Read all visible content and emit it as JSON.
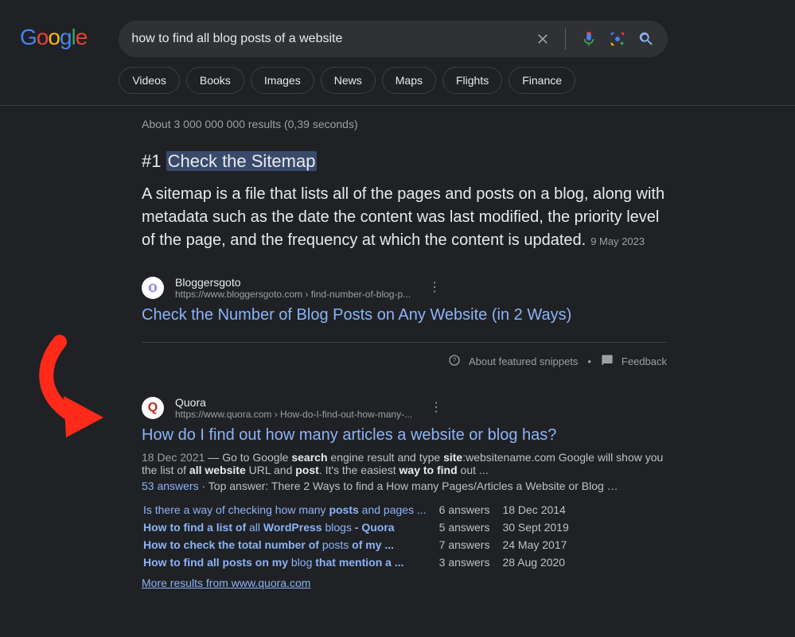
{
  "search": {
    "query": "how to find all blog posts of a website"
  },
  "tabs": [
    "Videos",
    "Books",
    "Images",
    "News",
    "Maps",
    "Flights",
    "Finance"
  ],
  "stats": "About 3 000 000 000 results (0,39 seconds)",
  "featured": {
    "prefix": "#1 ",
    "highlight": "Check the Sitemap",
    "body": "A sitemap is a file that lists all of the pages and posts on a blog, along with metadata such as the date the content was last modified, the priority level of the page, and the frequency at which the content is updated.",
    "date": "9 May 2023",
    "source_name": "Bloggersgoto",
    "source_url": "https://www.bloggersgoto.com › find-number-of-blog-p...",
    "title": "Check the Number of Blog Posts on Any Website (in 2 Ways)",
    "about": "About featured snippets",
    "feedback": "Feedback"
  },
  "result2": {
    "source_name": "Quora",
    "source_url": "https://www.quora.com › How-do-I-find-out-how-many-...",
    "title": "How do I find out how many articles a website or blog has?",
    "meta_date": "18 Dec 2021",
    "meta_sep": " — ",
    "meta_t1": "Go to Google ",
    "meta_b1": "search",
    "meta_t2": " engine result and type ",
    "meta_b2": "site",
    "meta_t3": ":websitename.com Google will show you the list of ",
    "meta_b3": "all website",
    "meta_t4": " URL and ",
    "meta_b4": "post",
    "meta_t5": ". It's the easiest ",
    "meta_b5": "way to find",
    "meta_t6": " out ...",
    "answers_link": "53 answers",
    "answers_sep": " · ",
    "top_label": "Top answer: ",
    "top_text": "There 2 Ways to find a How many Pages/Articles a Website or Blog …",
    "related": [
      {
        "q_parts": [
          "Is there a way of checking how many ",
          "posts",
          " and pages ..."
        ],
        "ans": "6 answers",
        "date": "18 Dec 2014"
      },
      {
        "q_parts": [
          "How to find",
          " a list of ",
          "all",
          " WordPress ",
          "blogs",
          " - Quora"
        ],
        "ans": "5 answers",
        "date": "30 Sept 2019"
      },
      {
        "q_parts": [
          "How to check",
          " the total number of ",
          "posts",
          " of my ..."
        ],
        "ans": "7 answers",
        "date": "24 May 2017"
      },
      {
        "q_parts": [
          "How to find all posts",
          " on my ",
          "blog",
          " that mention a ..."
        ],
        "ans": "3 answers",
        "date": "28 Aug 2020"
      }
    ],
    "more": "More results from www.quora.com"
  }
}
